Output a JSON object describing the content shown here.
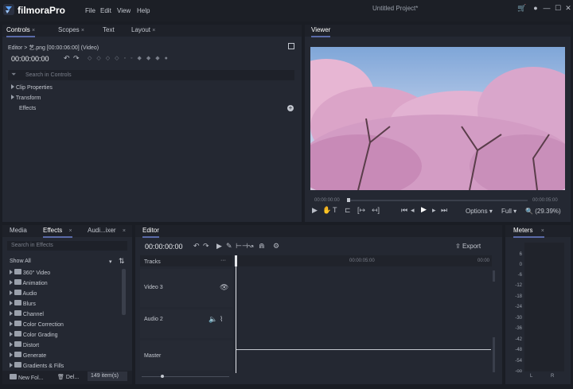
{
  "app": {
    "title": "filmoraPro",
    "project_title": "Untitled Project*"
  },
  "menu": [
    "File",
    "Edit",
    "View",
    "Help"
  ],
  "top_panel_tabs": [
    {
      "label": "Controls",
      "close": "×"
    },
    {
      "label": "Scopes",
      "close": "×"
    },
    {
      "label": "Text"
    },
    {
      "label": "Layout",
      "close": "×"
    }
  ],
  "controls": {
    "breadcrumb": "Editor > 艺.png [00:00:06:00] (Video)",
    "timecode": "00:00:00:00",
    "search_placeholder": "Search in Controls",
    "tree": [
      "Clip Properties",
      "Transform",
      "Effects"
    ]
  },
  "viewer": {
    "tab": "Viewer",
    "time_start": "00:00:00:00",
    "time_end": "00:00:05:00",
    "options_label": "Options",
    "quality_label": "Full",
    "zoom_label": "(29.39%)"
  },
  "left_tabs": [
    {
      "label": "Media"
    },
    {
      "label": "Effects",
      "close": "×"
    },
    {
      "label": "Audi...ixer",
      "close": "×"
    }
  ],
  "effects": {
    "search_placeholder": "Search in Effects",
    "filter_label": "Show All",
    "categories": [
      "360° Video",
      "Animation",
      "Audio",
      "Blurs",
      "Channel",
      "Color Correction",
      "Color Grading",
      "Distort",
      "Generate",
      "Gradients & Fills"
    ],
    "footer": {
      "new_folder": "New Fol...",
      "delete": "Del...",
      "count": "149 item(s)"
    }
  },
  "editor": {
    "tab": "Editor",
    "timecode": "00:00:00:00",
    "export_label": "Export",
    "tracks_header": "Tracks",
    "tracks_menu": "···",
    "ruler": [
      "00:00:05:00",
      "00:00"
    ],
    "tracks": [
      "Video 3",
      "Audio 2",
      "Master"
    ]
  },
  "meters": {
    "tab": "Meters",
    "close": "×",
    "scale": [
      "6",
      "0",
      "-6",
      "-12",
      "-18",
      "-24",
      "-30",
      "-36",
      "-42",
      "-48",
      "-54",
      "-oo"
    ],
    "channels": [
      "L",
      "R"
    ]
  },
  "colors": {
    "accent": "#5a6aa8",
    "bg": "#1a1d24",
    "panel": "#242832"
  }
}
